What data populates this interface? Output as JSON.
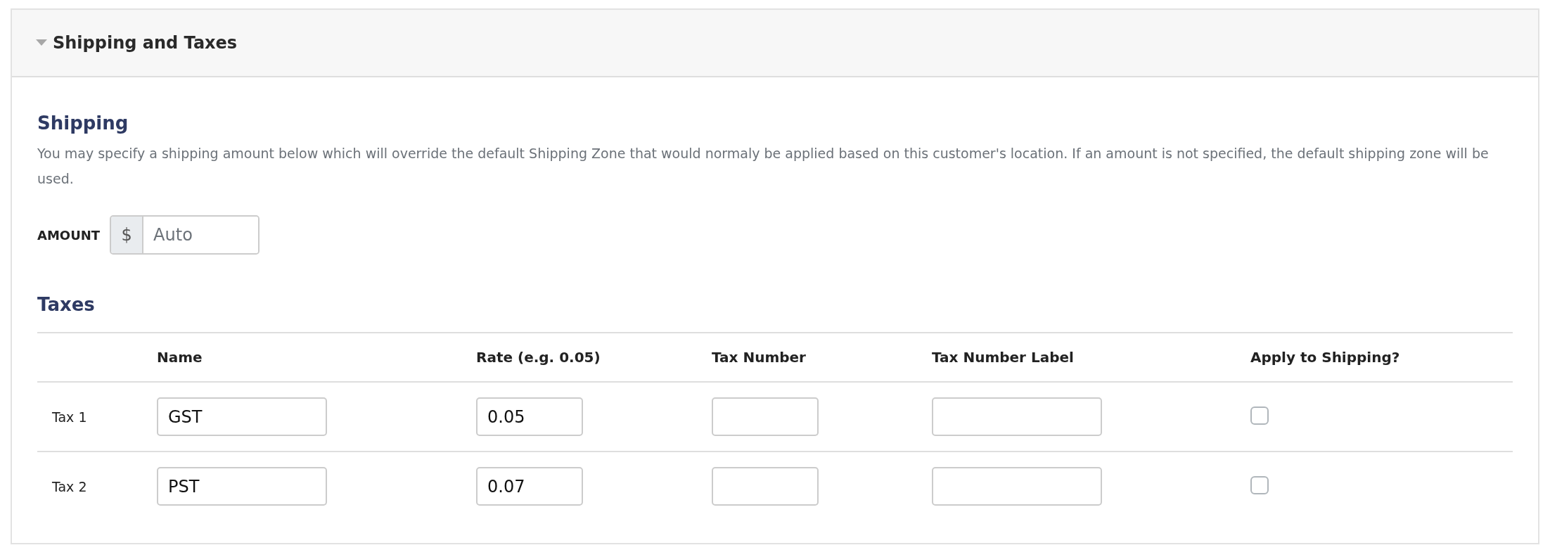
{
  "panel": {
    "title": "Shipping and Taxes",
    "expanded": true
  },
  "shipping": {
    "heading": "Shipping",
    "description": "You may specify a shipping amount below which will override the default Shipping Zone that would normaly be applied based on this customer's location. If an amount is not specified, the default shipping zone will be used.",
    "amount_label": "AMOUNT",
    "currency": "$",
    "amount_placeholder": "Auto"
  },
  "taxes": {
    "heading": "Taxes",
    "columns": [
      "Name",
      "Rate (e.g. 0.05)",
      "Tax Number",
      "Tax Number Label",
      "Apply to Shipping?"
    ],
    "rows": [
      {
        "label": "Tax 1",
        "name": "GST",
        "rate": "0.05",
        "apply_to_shipping": false
      },
      {
        "label": "Tax 2",
        "name": "PST",
        "rate": "0.07",
        "apply_to_shipping": false
      }
    ]
  }
}
